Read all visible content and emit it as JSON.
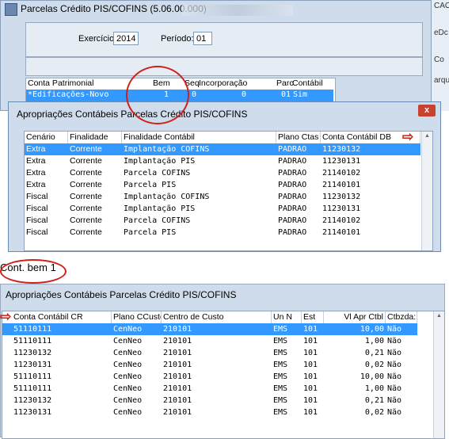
{
  "bg_window": {
    "title": "Parcelas Crédito PIS/COFINS (5.06.00.000)",
    "exercicio_label": "Exercício:",
    "exercicio_value": "2014",
    "periodo_label": "Período:",
    "periodo_value": "01",
    "grid": {
      "headers": [
        "Conta Patrimonial",
        "Bem",
        "Seq",
        "Incorporação",
        "Parc",
        "Contábil"
      ],
      "row": [
        "*Edificações-Novo",
        "1",
        "0",
        "0",
        "01",
        "Sim"
      ]
    },
    "side_texts": [
      "CAO",
      "eDc",
      "Co",
      "arqui"
    ]
  },
  "dialog1": {
    "title": "Apropriações Contábeis Parcelas Crédito PIS/COFINS",
    "close_label": "x",
    "headers": [
      "Cenário",
      "Finalidade",
      "Finalidade Contábil",
      "Plano Ctas",
      "Conta Contábil DB"
    ],
    "rows": [
      [
        "Extra",
        "Corrente",
        "Implantação COFINS",
        "PADRAO",
        "11230132"
      ],
      [
        "Extra",
        "Corrente",
        "Implantação PIS",
        "PADRAO",
        "11230131"
      ],
      [
        "Extra",
        "Corrente",
        "Parcela COFINS",
        "PADRAO",
        "21140102"
      ],
      [
        "Extra",
        "Corrente",
        "Parcela PIS",
        "PADRAO",
        "21140101"
      ],
      [
        "Fiscal",
        "Corrente",
        "Implantação COFINS",
        "PADRAO",
        "11230132"
      ],
      [
        "Fiscal",
        "Corrente",
        "Implantação PIS",
        "PADRAO",
        "11230131"
      ],
      [
        "Fiscal",
        "Corrente",
        "Parcela COFINS",
        "PADRAO",
        "21140102"
      ],
      [
        "Fiscal",
        "Corrente",
        "Parcela PIS",
        "PADRAO",
        "21140101"
      ]
    ]
  },
  "annotation_label": "Cont. bem 1",
  "dialog2": {
    "title": "Apropriações Contábeis Parcelas Crédito PIS/COFINS",
    "headers": [
      "Conta Contábil CR",
      "Plano CCusto",
      "Centro de Custo",
      "Un N",
      "Est",
      "Vl Apr Ctbl",
      "Ctbzda:"
    ],
    "rows": [
      [
        "51110111",
        "CenNeo",
        "210101",
        "EMS",
        "101",
        "10,00",
        "Não"
      ],
      [
        "51110111",
        "CenNeo",
        "210101",
        "EMS",
        "101",
        "1,00",
        "Não"
      ],
      [
        "11230132",
        "CenNeo",
        "210101",
        "EMS",
        "101",
        "0,21",
        "Não"
      ],
      [
        "11230131",
        "CenNeo",
        "210101",
        "EMS",
        "101",
        "0,02",
        "Não"
      ],
      [
        "51110111",
        "CenNeo",
        "210101",
        "EMS",
        "101",
        "10,00",
        "Não"
      ],
      [
        "51110111",
        "CenNeo",
        "210101",
        "EMS",
        "101",
        "1,00",
        "Não"
      ],
      [
        "11230132",
        "CenNeo",
        "210101",
        "EMS",
        "101",
        "0,21",
        "Não"
      ],
      [
        "11230131",
        "CenNeo",
        "210101",
        "EMS",
        "101",
        "0,02",
        "Não"
      ]
    ]
  },
  "colors": {
    "selection": "#3399ff",
    "annotation": "#d0201c"
  }
}
